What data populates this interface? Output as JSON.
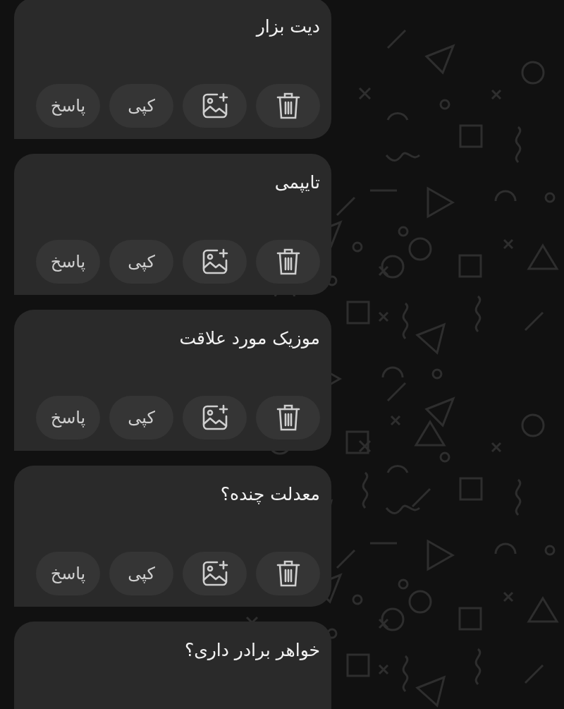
{
  "messages": [
    {
      "text": "دیت بزار",
      "actions": [
        {
          "kind": "delete"
        },
        {
          "kind": "add-image"
        },
        {
          "kind": "copy",
          "label": "کپی"
        },
        {
          "kind": "reply",
          "label": "پاسخ"
        }
      ]
    },
    {
      "text": "تایپمی",
      "actions": [
        {
          "kind": "delete"
        },
        {
          "kind": "add-image"
        },
        {
          "kind": "copy",
          "label": "کپی"
        },
        {
          "kind": "reply",
          "label": "پاسخ"
        }
      ]
    },
    {
      "text": "موزیک مورد علاقت",
      "actions": [
        {
          "kind": "delete"
        },
        {
          "kind": "add-image"
        },
        {
          "kind": "copy",
          "label": "کپی"
        },
        {
          "kind": "reply",
          "label": "پاسخ"
        }
      ]
    },
    {
      "text": "معدلت چنده؟",
      "actions": [
        {
          "kind": "delete"
        },
        {
          "kind": "add-image"
        },
        {
          "kind": "copy",
          "label": "کپی"
        },
        {
          "kind": "reply",
          "label": "پاسخ"
        }
      ]
    },
    {
      "text": "خواهر برادر داری؟"
    }
  ]
}
